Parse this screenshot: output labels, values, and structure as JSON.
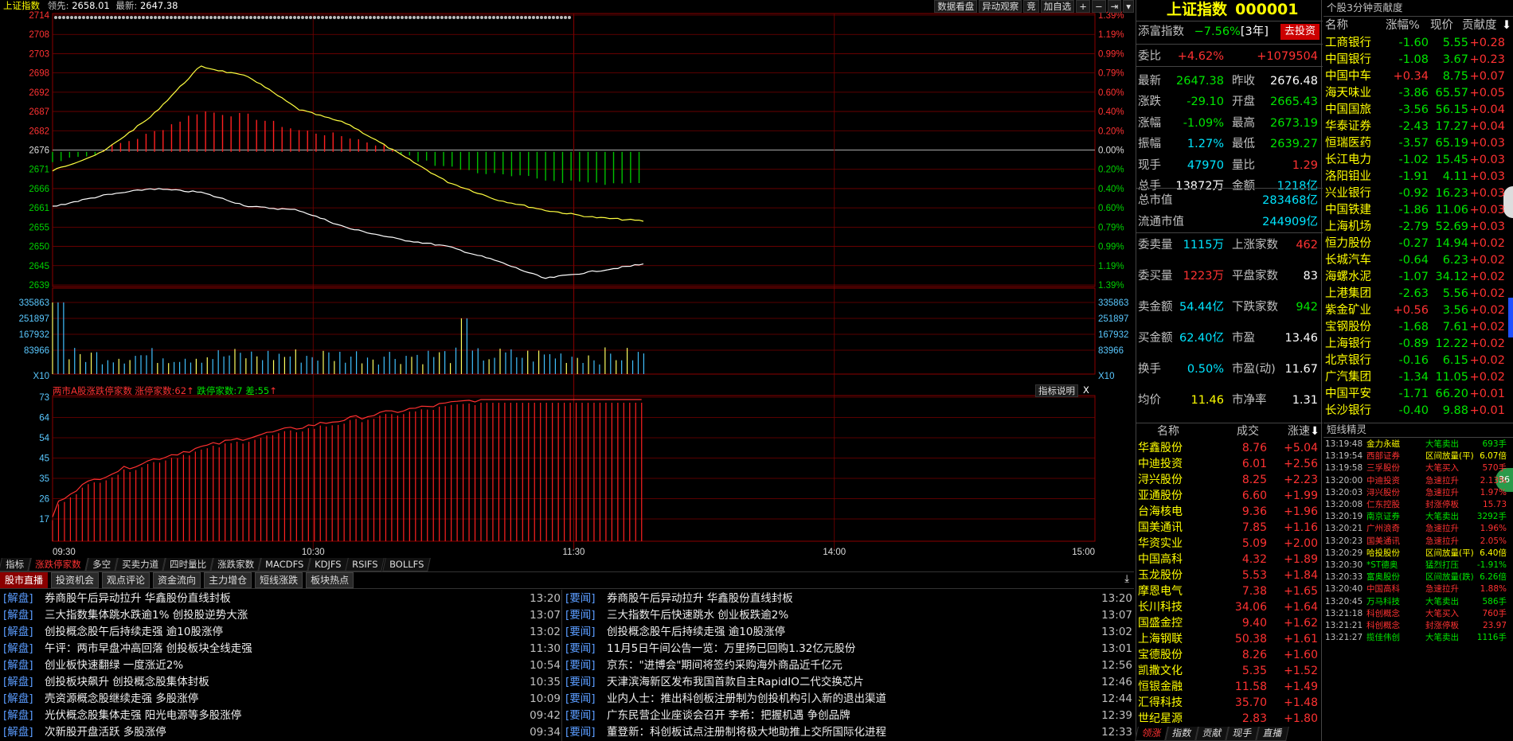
{
  "header": {
    "title": "上证指数",
    "lead_label": "领先:",
    "lead_value": "2658.01",
    "latest_label": "最新:",
    "latest_value": "2647.38"
  },
  "toolbar": {
    "buttons": [
      "数据看盘",
      "异动观察",
      "竞",
      "加自选",
      "+",
      "−",
      "⇥",
      "▾"
    ]
  },
  "price_axis": {
    "left": [
      "2714",
      "2708",
      "2703",
      "2698",
      "2692",
      "2687",
      "2682",
      "2676",
      "2671",
      "2666",
      "2661",
      "2655",
      "2650",
      "2645",
      "2639"
    ],
    "right": [
      "1.39%",
      "1.19%",
      "0.99%",
      "0.79%",
      "0.60%",
      "0.40%",
      "0.20%",
      "0.00%",
      "0.20%",
      "0.40%",
      "0.60%",
      "0.79%",
      "0.99%",
      "1.19%",
      "1.39%"
    ]
  },
  "volume_axis": {
    "left": [
      "335863",
      "251897",
      "167932",
      "83966",
      "X10"
    ],
    "right": [
      "335863",
      "251897",
      "167932",
      "83966",
      "X10"
    ]
  },
  "lower_chart": {
    "title": "两市A股涨跌停家数",
    "limit_up_label": "涨停家数:",
    "limit_up_value": "62",
    "limit_down_label": "跌停家数:",
    "limit_down_value": "7",
    "diff_label": "差:",
    "diff_value": "55",
    "help": "指标说明",
    "close": "X",
    "yticks": [
      "73",
      "64",
      "54",
      "45",
      "35",
      "26",
      "17"
    ]
  },
  "time_axis": [
    "09:30",
    "10:30",
    "11:30",
    "14:00",
    "15:00"
  ],
  "chart_data": {
    "type": "line",
    "x": [
      "09:30",
      "10:30",
      "11:30",
      "14:00",
      "15:00"
    ],
    "series": [
      {
        "values": [
          2671,
          2676,
          2686,
          2700,
          2697,
          2688,
          2684,
          2676,
          2668,
          2663,
          2660,
          2658,
          2657
        ]
      },
      {
        "values": [
          2661,
          2664,
          2666,
          2665,
          2661,
          2660,
          2655,
          2652,
          2650,
          2646,
          2641,
          2643,
          2645
        ]
      }
    ]
  },
  "indicator_tabs": [
    "指标",
    "涨跌停家数",
    "多空",
    "买卖力道",
    "四时量比",
    "涨跌家数",
    "MACDFS",
    "KDJFS",
    "RSIFS",
    "BOLLFS"
  ],
  "news_tabs": [
    "股市直播",
    "投资机会",
    "观点评论",
    "资金流向",
    "主力增仓",
    "短线涨跌",
    "板块热点"
  ],
  "news_left": [
    {
      "tag": "[解盘]",
      "text": "券商股午后异动拉升 华鑫股份直线封板",
      "time": "13:20"
    },
    {
      "tag": "[解盘]",
      "text": "三大指数集体跳水跌逾1% 创投股逆势大涨",
      "time": "13:07"
    },
    {
      "tag": "[解盘]",
      "text": "创投概念股午后持续走强 逾10股涨停",
      "time": "13:02"
    },
    {
      "tag": "[解盘]",
      "text": "午评：两市早盘冲高回落 创投板块全线走强",
      "time": "11:30"
    },
    {
      "tag": "[解盘]",
      "text": "创业板快速翻绿 一度涨近2%",
      "time": "10:54"
    },
    {
      "tag": "[解盘]",
      "text": "创投板块飙升 创投概念股集体封板",
      "time": "10:35"
    },
    {
      "tag": "[解盘]",
      "text": "壳资源概念股继续走强 多股涨停",
      "time": "10:09"
    },
    {
      "tag": "[解盘]",
      "text": "光伏概念股集体走强 阳光电源等多股涨停",
      "time": "09:42"
    },
    {
      "tag": "[解盘]",
      "text": "次新股开盘活跃 多股涨停",
      "time": "09:34"
    }
  ],
  "news_right": [
    {
      "tag": "[要闻]",
      "text": "券商股午后异动拉升 华鑫股份直线封板",
      "time": "13:20"
    },
    {
      "tag": "[要闻]",
      "text": "三大指数午后快速跳水 创业板跌逾2%",
      "time": "13:07"
    },
    {
      "tag": "[要闻]",
      "text": "创投概念股午后持续走强 逾10股涨停",
      "time": "13:02"
    },
    {
      "tag": "[要闻]",
      "text": "11月5日午间公告一览：万里扬已回购1.32亿元股份",
      "time": "13:01"
    },
    {
      "tag": "[要闻]",
      "text": "京东：\"进博会\"期间将签约采购海外商品近千亿元",
      "time": "12:56"
    },
    {
      "tag": "[要闻]",
      "text": "天津滨海新区发布我国首款自主RapidIO二代交换芯片",
      "time": "12:46"
    },
    {
      "tag": "[要闻]",
      "text": "业内人士：推出科创板注册制为创投机构引入新的退出渠道",
      "time": "12:44"
    },
    {
      "tag": "[要闻]",
      "text": "广东民营企业座谈会召开 李希：把握机遇 争创品牌",
      "time": "12:39"
    },
    {
      "tag": "[要闻]",
      "text": "董登新：科创板试点注册制将极大地助推上交所国际化进程",
      "time": "12:33"
    }
  ],
  "quote": {
    "name": "上证指数",
    "code": "000001",
    "fund_label": "添富指数",
    "fund_change": "−7.56%",
    "fund_period": "[3年]",
    "invest_btn": "去投资",
    "rows": [
      {
        "l": "委比",
        "v": "+4.62%",
        "vc": "red",
        "l2": "",
        "v2": "+1079504",
        "v2c": "red"
      },
      {
        "l": "最新",
        "v": "2647.38",
        "vc": "green",
        "l2": "昨收",
        "v2": "2676.48",
        "v2c": "white"
      },
      {
        "l": "涨跌",
        "v": "-29.10",
        "vc": "green",
        "l2": "开盘",
        "v2": "2665.43",
        "v2c": "green"
      },
      {
        "l": "涨幅",
        "v": "-1.09%",
        "vc": "green",
        "l2": "最高",
        "v2": "2673.19",
        "v2c": "green"
      },
      {
        "l": "振幅",
        "v": "1.27%",
        "vc": "cyan",
        "l2": "最低",
        "v2": "2639.27",
        "v2c": "green"
      },
      {
        "l": "现手",
        "v": "47970",
        "vc": "cyan",
        "l2": "量比",
        "v2": "1.29",
        "v2c": "red"
      },
      {
        "l": "总手",
        "v": "13872万",
        "vc": "white",
        "l2": "金额",
        "v2": "1218亿",
        "v2c": "cyan"
      }
    ],
    "cap_rows": [
      {
        "l": "总市值",
        "v": "283468亿",
        "vc": "cyan"
      },
      {
        "l": "流通市值",
        "v": "244909亿",
        "vc": "cyan"
      }
    ],
    "rows2": [
      {
        "l": "委卖量",
        "v": "1115万",
        "vc": "cyan",
        "l2": "上涨家数",
        "v2": "462",
        "v2c": "red"
      },
      {
        "l": "委买量",
        "v": "1223万",
        "vc": "red",
        "l2": "平盘家数",
        "v2": "83",
        "v2c": "white"
      },
      {
        "l": "卖金额",
        "v": "54.44亿",
        "vc": "cyan",
        "l2": "下跌家数",
        "v2": "942",
        "v2c": "green"
      },
      {
        "l": "买金额",
        "v": "62.40亿",
        "vc": "cyan",
        "l2": "市盈",
        "v2": "13.46",
        "v2c": "white"
      },
      {
        "l": "换手",
        "v": "0.50%",
        "vc": "cyan",
        "l2": "市盈(动)",
        "v2": "11.67",
        "v2c": "white"
      },
      {
        "l": "均价",
        "v": "11.46",
        "vc": "yellow",
        "l2": "市净率",
        "v2": "1.31",
        "v2c": "white"
      }
    ],
    "list_header": [
      "名称",
      "成交",
      "涨速"
    ],
    "list": [
      {
        "n": "华鑫股份",
        "p": "8.76",
        "c": "+5.04"
      },
      {
        "n": "中迪投资",
        "p": "6.01",
        "c": "+2.56"
      },
      {
        "n": "浔兴股份",
        "p": "8.25",
        "c": "+2.23"
      },
      {
        "n": "亚通股份",
        "p": "6.60",
        "c": "+1.99"
      },
      {
        "n": "台海核电",
        "p": "9.36",
        "c": "+1.96"
      },
      {
        "n": "国美通讯",
        "p": "7.85",
        "c": "+1.16"
      },
      {
        "n": "华资实业",
        "p": "5.09",
        "c": "+2.00"
      },
      {
        "n": "中国高科",
        "p": "4.32",
        "c": "+1.89"
      },
      {
        "n": "玉龙股份",
        "p": "5.53",
        "c": "+1.84"
      },
      {
        "n": "摩恩电气",
        "p": "7.38",
        "c": "+1.65"
      },
      {
        "n": "长川科技",
        "p": "34.06",
        "c": "+1.64"
      },
      {
        "n": "国盛金控",
        "p": "9.40",
        "c": "+1.62"
      },
      {
        "n": "上海钢联",
        "p": "50.38",
        "c": "+1.61"
      },
      {
        "n": "宝德股份",
        "p": "8.26",
        "c": "+1.60"
      },
      {
        "n": "凯撒文化",
        "p": "5.35",
        "c": "+1.52"
      },
      {
        "n": "恒银金融",
        "p": "11.58",
        "c": "+1.49"
      },
      {
        "n": "汇得科技",
        "p": "35.70",
        "c": "+1.48"
      },
      {
        "n": "世纪星源",
        "p": "2.83",
        "c": "+1.80"
      }
    ],
    "bottom_tabs": [
      "领涨",
      "指数",
      "贡献",
      "现手",
      "直播"
    ]
  },
  "contrib": {
    "title": "个股3分钟贡献度",
    "header": [
      "名称",
      "涨幅%",
      "现价",
      "贡献度"
    ],
    "rows": [
      {
        "n": "工商银行",
        "a": "-1.60",
        "ac": "green",
        "b": "5.55",
        "d": "+0.28"
      },
      {
        "n": "中国银行",
        "a": "-1.08",
        "ac": "green",
        "b": "3.67",
        "d": "+0.23"
      },
      {
        "n": "中国中车",
        "a": "+0.34",
        "ac": "red",
        "b": "8.75",
        "d": "+0.07"
      },
      {
        "n": "海天味业",
        "a": "-3.86",
        "ac": "green",
        "b": "65.57",
        "d": "+0.05"
      },
      {
        "n": "中国国旅",
        "a": "-3.56",
        "ac": "green",
        "b": "56.15",
        "d": "+0.04"
      },
      {
        "n": "华泰证券",
        "a": "-2.43",
        "ac": "green",
        "b": "17.27",
        "d": "+0.04"
      },
      {
        "n": "恒瑞医药",
        "a": "-3.57",
        "ac": "green",
        "b": "65.19",
        "d": "+0.03"
      },
      {
        "n": "长江电力",
        "a": "-1.02",
        "ac": "green",
        "b": "15.45",
        "d": "+0.03"
      },
      {
        "n": "洛阳钼业",
        "a": "-1.91",
        "ac": "green",
        "b": "4.11",
        "d": "+0.03"
      },
      {
        "n": "兴业银行",
        "a": "-0.92",
        "ac": "green",
        "b": "16.23",
        "d": "+0.03"
      },
      {
        "n": "中国铁建",
        "a": "-1.86",
        "ac": "green",
        "b": "11.06",
        "d": "+0.03"
      },
      {
        "n": "上海机场",
        "a": "-2.79",
        "ac": "green",
        "b": "52.69",
        "d": "+0.03"
      },
      {
        "n": "恒力股份",
        "a": "-0.27",
        "ac": "green",
        "b": "14.94",
        "d": "+0.02"
      },
      {
        "n": "长城汽车",
        "a": "-0.64",
        "ac": "green",
        "b": "6.23",
        "d": "+0.02"
      },
      {
        "n": "海螺水泥",
        "a": "-1.07",
        "ac": "green",
        "b": "34.12",
        "d": "+0.02"
      },
      {
        "n": "上港集团",
        "a": "-2.63",
        "ac": "green",
        "b": "5.56",
        "d": "+0.02"
      },
      {
        "n": "紫金矿业",
        "a": "+0.56",
        "ac": "red",
        "b": "3.56",
        "d": "+0.02"
      },
      {
        "n": "宝钢股份",
        "a": "-1.68",
        "ac": "green",
        "b": "7.61",
        "d": "+0.02"
      },
      {
        "n": "上海银行",
        "a": "-0.89",
        "ac": "green",
        "b": "12.22",
        "d": "+0.02"
      },
      {
        "n": "北京银行",
        "a": "-0.16",
        "ac": "green",
        "b": "6.15",
        "d": "+0.02"
      },
      {
        "n": "广汽集团",
        "a": "-1.34",
        "ac": "green",
        "b": "11.05",
        "d": "+0.02"
      },
      {
        "n": "中国平安",
        "a": "-1.71",
        "ac": "green",
        "b": "66.20",
        "d": "+0.01"
      },
      {
        "n": "长沙银行",
        "a": "-0.40",
        "ac": "green",
        "b": "9.88",
        "d": "+0.01"
      }
    ],
    "elves_title": "短线精灵",
    "elves": [
      {
        "t": "13:19:48",
        "s": "金力永磁",
        "sc": "yellow",
        "k": "大笔卖出",
        "kc": "green",
        "v": "693手",
        "vc": "green"
      },
      {
        "t": "13:19:54",
        "s": "西部证券",
        "sc": "red",
        "k": "区间放量(平)",
        "kc": "yellow",
        "v": "6.07倍",
        "vc": "yellow"
      },
      {
        "t": "13:19:58",
        "s": "三孚股份",
        "sc": "red",
        "k": "大笔买入",
        "kc": "red",
        "v": "570手",
        "vc": "red"
      },
      {
        "t": "13:20:00",
        "s": "中迪投资",
        "sc": "red",
        "k": "急速拉升",
        "kc": "red",
        "v": "2.13%",
        "vc": "red"
      },
      {
        "t": "13:20:03",
        "s": "浔兴股份",
        "sc": "red",
        "k": "急速拉升",
        "kc": "red",
        "v": "1.97%",
        "vc": "red"
      },
      {
        "t": "13:20:08",
        "s": "仁东控股",
        "sc": "red",
        "k": "封涨停板",
        "kc": "red",
        "v": "15.73",
        "vc": "red"
      },
      {
        "t": "13:20:19",
        "s": "南京证券",
        "sc": "green",
        "k": "大笔卖出",
        "kc": "green",
        "v": "3292手",
        "vc": "green"
      },
      {
        "t": "13:20:21",
        "s": "广州浪奇",
        "sc": "red",
        "k": "急速拉升",
        "kc": "red",
        "v": "1.96%",
        "vc": "red"
      },
      {
        "t": "13:20:23",
        "s": "国美通讯",
        "sc": "red",
        "k": "急速拉升",
        "kc": "red",
        "v": "2.05%",
        "vc": "red"
      },
      {
        "t": "13:20:29",
        "s": "哈投股份",
        "sc": "yellow",
        "k": "区间放量(平)",
        "kc": "yellow",
        "v": "6.40倍",
        "vc": "yellow"
      },
      {
        "t": "13:20:30",
        "s": "*ST德奥",
        "sc": "green",
        "k": "猛烈打压",
        "kc": "green",
        "v": "-1.91%",
        "vc": "green"
      },
      {
        "t": "13:20:33",
        "s": "富奥股份",
        "sc": "green",
        "k": "区间放量(跌)",
        "kc": "green",
        "v": "6.26倍",
        "vc": "green"
      },
      {
        "t": "13:20:40",
        "s": "中国高科",
        "sc": "red",
        "k": "急速拉升",
        "kc": "red",
        "v": "1.88%",
        "vc": "red"
      },
      {
        "t": "13:20:45",
        "s": "万马科技",
        "sc": "green",
        "k": "大笔卖出",
        "kc": "green",
        "v": "586手",
        "vc": "green"
      },
      {
        "t": "13:21:18",
        "s": "科创概念",
        "sc": "red",
        "k": "大笔买入",
        "kc": "red",
        "v": "760手",
        "vc": "red"
      },
      {
        "t": "13:21:21",
        "s": "科创概念",
        "sc": "red",
        "k": "封涨停板",
        "kc": "red",
        "v": "23.97",
        "vc": "red"
      },
      {
        "t": "13:21:27",
        "s": "揽佳伟创",
        "sc": "green",
        "k": "大笔卖出",
        "kc": "green",
        "v": "1116手",
        "vc": "green"
      }
    ]
  }
}
